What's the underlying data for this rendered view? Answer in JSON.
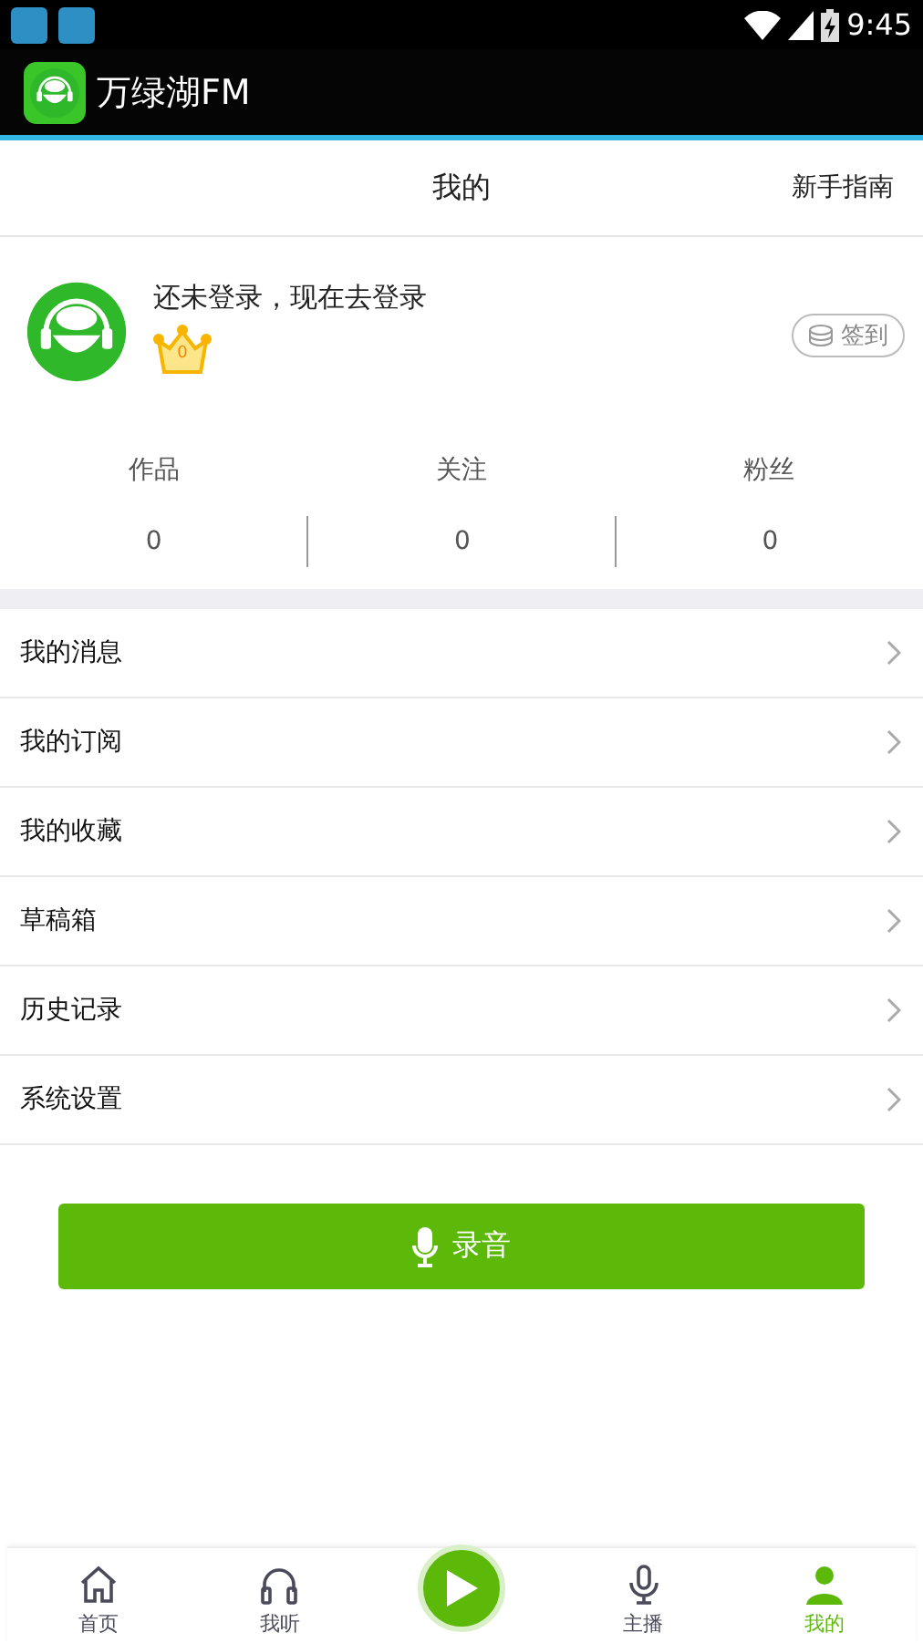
{
  "status_bar": {
    "time": "9:45"
  },
  "app_bar": {
    "title": "万绿湖FM"
  },
  "header": {
    "title": "我的",
    "guide_link": "新手指南"
  },
  "profile": {
    "login_prompt": "还未登录，现在去登录",
    "level": "0",
    "checkin_button": "签到"
  },
  "stats": [
    {
      "label": "作品",
      "value": "0"
    },
    {
      "label": "关注",
      "value": "0"
    },
    {
      "label": "粉丝",
      "value": "0"
    }
  ],
  "menu": [
    "我的消息",
    "我的订阅",
    "我的收藏",
    "草稿箱",
    "历史记录",
    "系统设置"
  ],
  "record_button": "录音",
  "bottom_nav": [
    {
      "kind": "home",
      "label": "首页",
      "selected": false
    },
    {
      "kind": "listen",
      "label": "我听",
      "selected": false
    },
    {
      "kind": "play"
    },
    {
      "kind": "host",
      "label": "主播",
      "selected": false
    },
    {
      "kind": "me",
      "label": "我的",
      "selected": true
    }
  ]
}
